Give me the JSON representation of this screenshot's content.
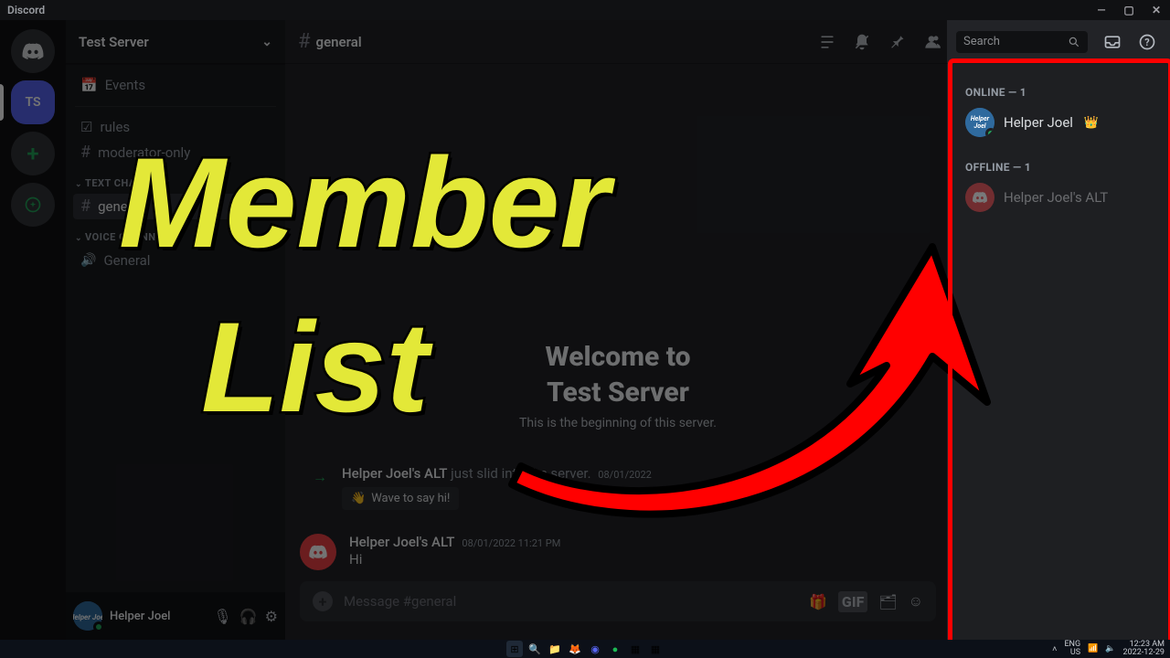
{
  "window": {
    "app_name": "Discord"
  },
  "overlay": {
    "line1": "Member",
    "line2": "List"
  },
  "rail": {
    "ts_label": "TS"
  },
  "server": {
    "name": "Test Server"
  },
  "sidebar": {
    "events": "Events",
    "text_category": "TEXT CHANNELS",
    "voice_category": "VOICE CHANNELS",
    "channels": {
      "rules": "rules",
      "mods": "moderator-only",
      "general": "general",
      "voice_general": "General"
    }
  },
  "header": {
    "channel": "general",
    "search_placeholder": "Search"
  },
  "chat": {
    "welcome_line1": "Welcome to",
    "welcome_line2": "Test Server",
    "welcome_sub": "This is the beginning of this server.",
    "join_user": "Helper Joel's ALT",
    "join_text": " just slid into the server.",
    "join_date": "08/01/2022",
    "wave_label": "Wave to say hi!",
    "msg_user": "Helper Joel's ALT",
    "msg_time": "08/01/2022 11:21 PM",
    "msg_body": "Hi",
    "composer_placeholder": "Message #general",
    "gif_label": "GIF"
  },
  "members": {
    "online_header": "ONLINE — 1",
    "offline_header": "OFFLINE — 1",
    "online_name": "Helper Joel",
    "offline_name": "Helper Joel's ALT"
  },
  "user_panel": {
    "name": "Helper Joel"
  },
  "taskbar": {
    "lang1": "ENG",
    "lang2": "US",
    "time": "12:23 AM",
    "date": "2022-12-29"
  }
}
